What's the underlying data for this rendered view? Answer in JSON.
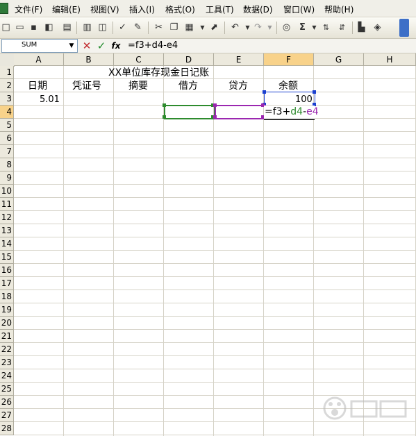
{
  "menu": [
    "文件(F)",
    "编辑(E)",
    "视图(V)",
    "插入(I)",
    "格式(O)",
    "工具(T)",
    "数据(D)",
    "窗口(W)",
    "帮助(H)"
  ],
  "name_box": "SUM",
  "formula": "=f3+d4-e4",
  "columns": [
    "A",
    "B",
    "C",
    "D",
    "E",
    "F",
    "G",
    "H"
  ],
  "rows": [
    "1",
    "2",
    "3",
    "4",
    "5",
    "6",
    "7",
    "8",
    "9",
    "10",
    "11",
    "12",
    "13",
    "14",
    "15",
    "16",
    "17",
    "18",
    "19",
    "20",
    "21",
    "22",
    "23",
    "24",
    "25",
    "26",
    "27",
    "28"
  ],
  "title": "XX单位库存现金日记账",
  "headers": {
    "date": "日期",
    "voucher": "凭证号",
    "summary": "摘要",
    "debit": "借方",
    "credit": "贷方",
    "balance": "余额"
  },
  "a3": "5.01",
  "f3": "100",
  "f4_edit": {
    "p1": "=f3+",
    "p2": "d4",
    "p3": "-",
    "p4": "e4"
  },
  "colors": {
    "debit_ref": "#2e8b2e",
    "credit_ref": "#9b27b0",
    "active_ref": "#1a3fcf"
  },
  "icons": [
    "new-icon",
    "open-icon",
    "save-icon",
    "permission-icon",
    "print-icon",
    "print-preview-icon",
    "spelling-icon",
    "research-icon",
    "cut-icon",
    "copy-icon",
    "paste-icon",
    "format-painter-icon",
    "undo-icon",
    "redo-icon",
    "hyperlink-icon",
    "autosum-icon",
    "sort-asc-icon",
    "sort-desc-icon",
    "chart-icon",
    "drawing-icon"
  ]
}
